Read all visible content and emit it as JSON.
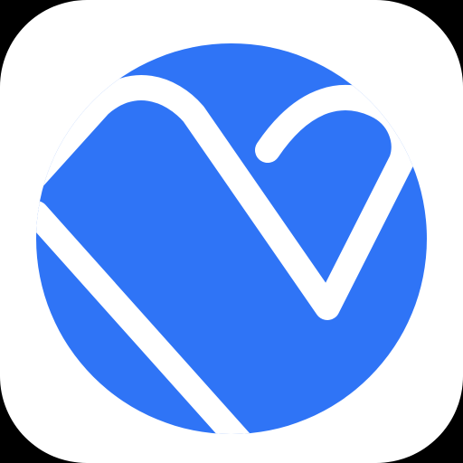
{
  "app_icon": {
    "name": "heart-check-logo-icon",
    "tile_color": "#FFFFFF",
    "background_color": "#000000",
    "accent_color": "#2F74F6",
    "mark_color": "#FFFFFF"
  }
}
